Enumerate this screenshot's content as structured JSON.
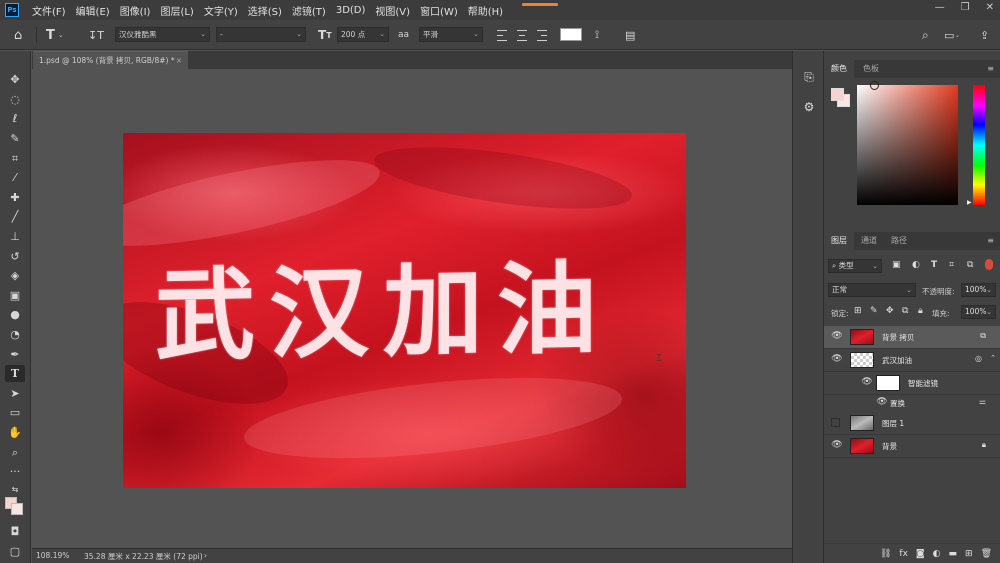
{
  "app": {
    "logo": "Ps"
  },
  "menu": [
    "文件(F)",
    "编辑(E)",
    "图像(I)",
    "图层(L)",
    "文字(Y)",
    "选择(S)",
    "滤镜(T)",
    "3D(D)",
    "视图(V)",
    "窗口(W)",
    "帮助(H)"
  ],
  "window_controls": {
    "minimize": "—",
    "restore": "❐",
    "close": "✕"
  },
  "options": {
    "font_family": "汉仪雅酷黑",
    "font_style": "-",
    "font_size": "200 点",
    "aa_label": "aa",
    "anti_alias": "平滑",
    "text_color": "#ffffff"
  },
  "document_tab": {
    "title": "1.psd @ 108% (背景 拷贝, RGB/8#) *",
    "close": "×"
  },
  "canvas": {
    "text": "武汉加油"
  },
  "status": {
    "zoom": "108.19%",
    "doc_info": "35.28 厘米 x 22.23 厘米 (72 ppi)",
    "arrow": "›"
  },
  "colors": {
    "foreground": "#f5d3cf",
    "background": "#f9e6e3"
  },
  "color_panel": {
    "tabs": [
      "颜色",
      "色板"
    ]
  },
  "layers_panel": {
    "tabs": [
      "图层",
      "通道",
      "路径"
    ],
    "filter_kind": "类型",
    "blend_mode": "正常",
    "opacity_label": "不透明度:",
    "opacity": "100%",
    "lock_label": "锁定:",
    "fill_label": "填充:",
    "fill": "100%",
    "layers": [
      {
        "name": "背景 拷贝",
        "visible": true,
        "selected": true
      },
      {
        "name": "武汉加油",
        "visible": true,
        "selected": false
      },
      {
        "name": "智能滤镜",
        "visible": true,
        "selected": false
      },
      {
        "name": "置换",
        "visible": true,
        "selected": false
      },
      {
        "name": "图层 1",
        "visible": false,
        "selected": false
      },
      {
        "name": "背景",
        "visible": true,
        "selected": false
      }
    ]
  }
}
